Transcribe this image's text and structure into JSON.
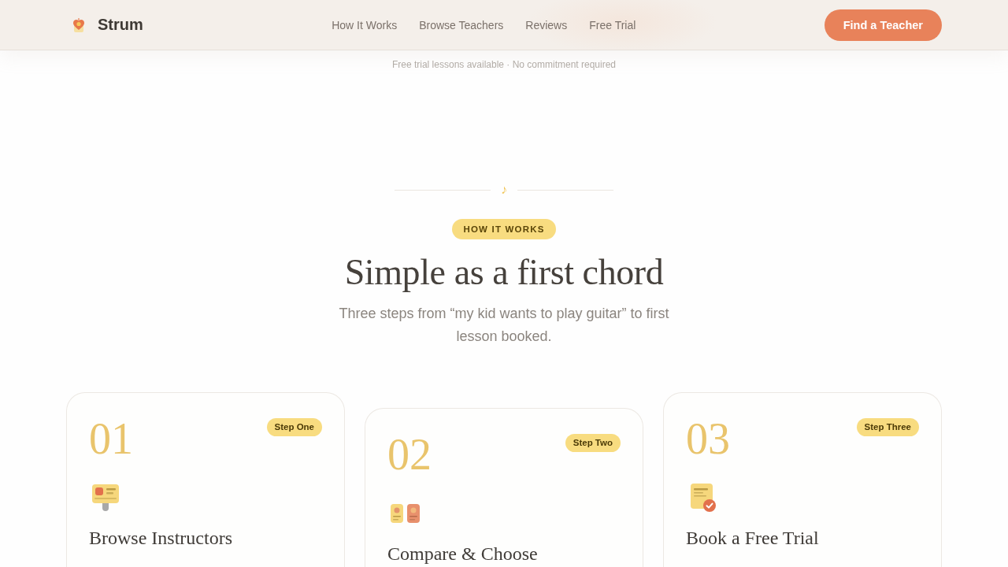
{
  "header": {
    "brand": "Strum",
    "nav": [
      "How It Works",
      "Browse Teachers",
      "Reviews",
      "Free Trial"
    ],
    "cta": "Find a Teacher"
  },
  "tagline": "Free trial lessons available · No commitment required",
  "section": {
    "divider_symbol": "♪",
    "eyebrow": "HOW IT WORKS",
    "title": "Simple as a first chord",
    "subtitle": "Three steps from “my kid wants to play guitar” to first lesson booked."
  },
  "steps": [
    {
      "number": "01",
      "badge": "Step One",
      "kind": "profile",
      "title": "Browse Instructors"
    },
    {
      "number": "02",
      "badge": "Step Two",
      "kind": "compare",
      "title": "Compare & Choose"
    },
    {
      "number": "03",
      "badge": "Step Three",
      "kind": "booking",
      "title": "Book a Free Trial"
    }
  ]
}
